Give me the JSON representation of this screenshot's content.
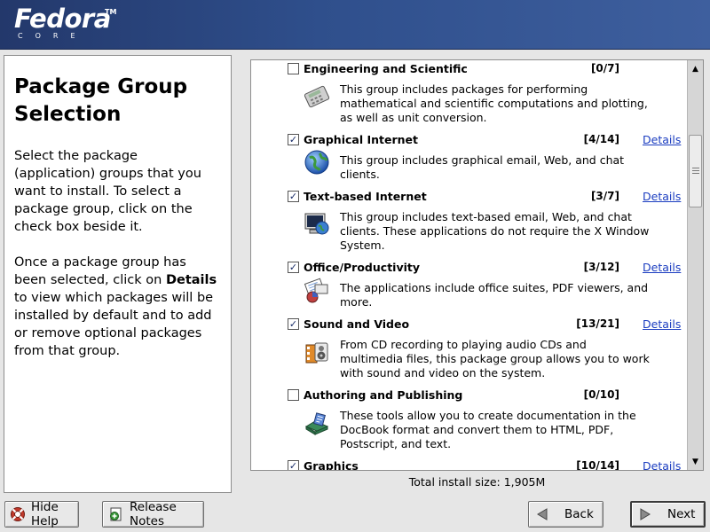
{
  "logo": {
    "word": "Fedora",
    "tm": "TM",
    "sub": "CORE"
  },
  "help": {
    "title": "Package Group Selection",
    "para1": "Select the package (application) groups that you want to install. To select a package group, click on the check box beside it.",
    "para2_before": "Once a package group has been selected, click on ",
    "para2_bold": "Details",
    "para2_after": " to view which packages will be installed by default and to add or remove optional packages from that group."
  },
  "groups": [
    {
      "name": "Engineering and Scientific",
      "checked": false,
      "count": "[0/7]",
      "details": "",
      "icon": "calculator-icon",
      "desc": "This group includes packages for performing mathematical and scientific computations and plotting, as well as unit conversion."
    },
    {
      "name": "Graphical Internet",
      "checked": true,
      "count": "[4/14]",
      "details": "Details",
      "icon": "globe-icon",
      "desc": "This group includes graphical email, Web, and chat clients."
    },
    {
      "name": "Text-based Internet",
      "checked": true,
      "count": "[3/7]",
      "details": "Details",
      "icon": "terminal-globe-icon",
      "desc": "This group includes text-based email, Web, and chat clients.  These applications do not require the X Window System."
    },
    {
      "name": "Office/Productivity",
      "checked": true,
      "count": "[3/12]",
      "details": "Details",
      "icon": "office-icon",
      "desc": "The applications include office suites, PDF viewers, and more."
    },
    {
      "name": "Sound and Video",
      "checked": true,
      "count": "[13/21]",
      "details": "Details",
      "icon": "multimedia-icon",
      "desc": "From CD recording to playing audio CDs and multimedia files, this package group allows you to work with sound and video on the system."
    },
    {
      "name": "Authoring and Publishing",
      "checked": false,
      "count": "[0/10]",
      "details": "",
      "icon": "publishing-icon",
      "desc": "These tools allow you to create documentation in the DocBook format and convert them to HTML, PDF, Postscript, and text."
    },
    {
      "name": "Graphics",
      "checked": true,
      "count": "[10/14]",
      "details": "Details",
      "icon": "graphics-icon",
      "desc": ""
    }
  ],
  "checkmark": "✓",
  "total_install_size": "Total install size: 1,905M",
  "buttons": {
    "hide_help": "Hide Help",
    "release_notes": "Release Notes",
    "back": "Back",
    "next": "Next"
  },
  "colors": {
    "header": "#2f4f8c",
    "link": "#1a3cc0",
    "check": "#1b2f6a"
  }
}
